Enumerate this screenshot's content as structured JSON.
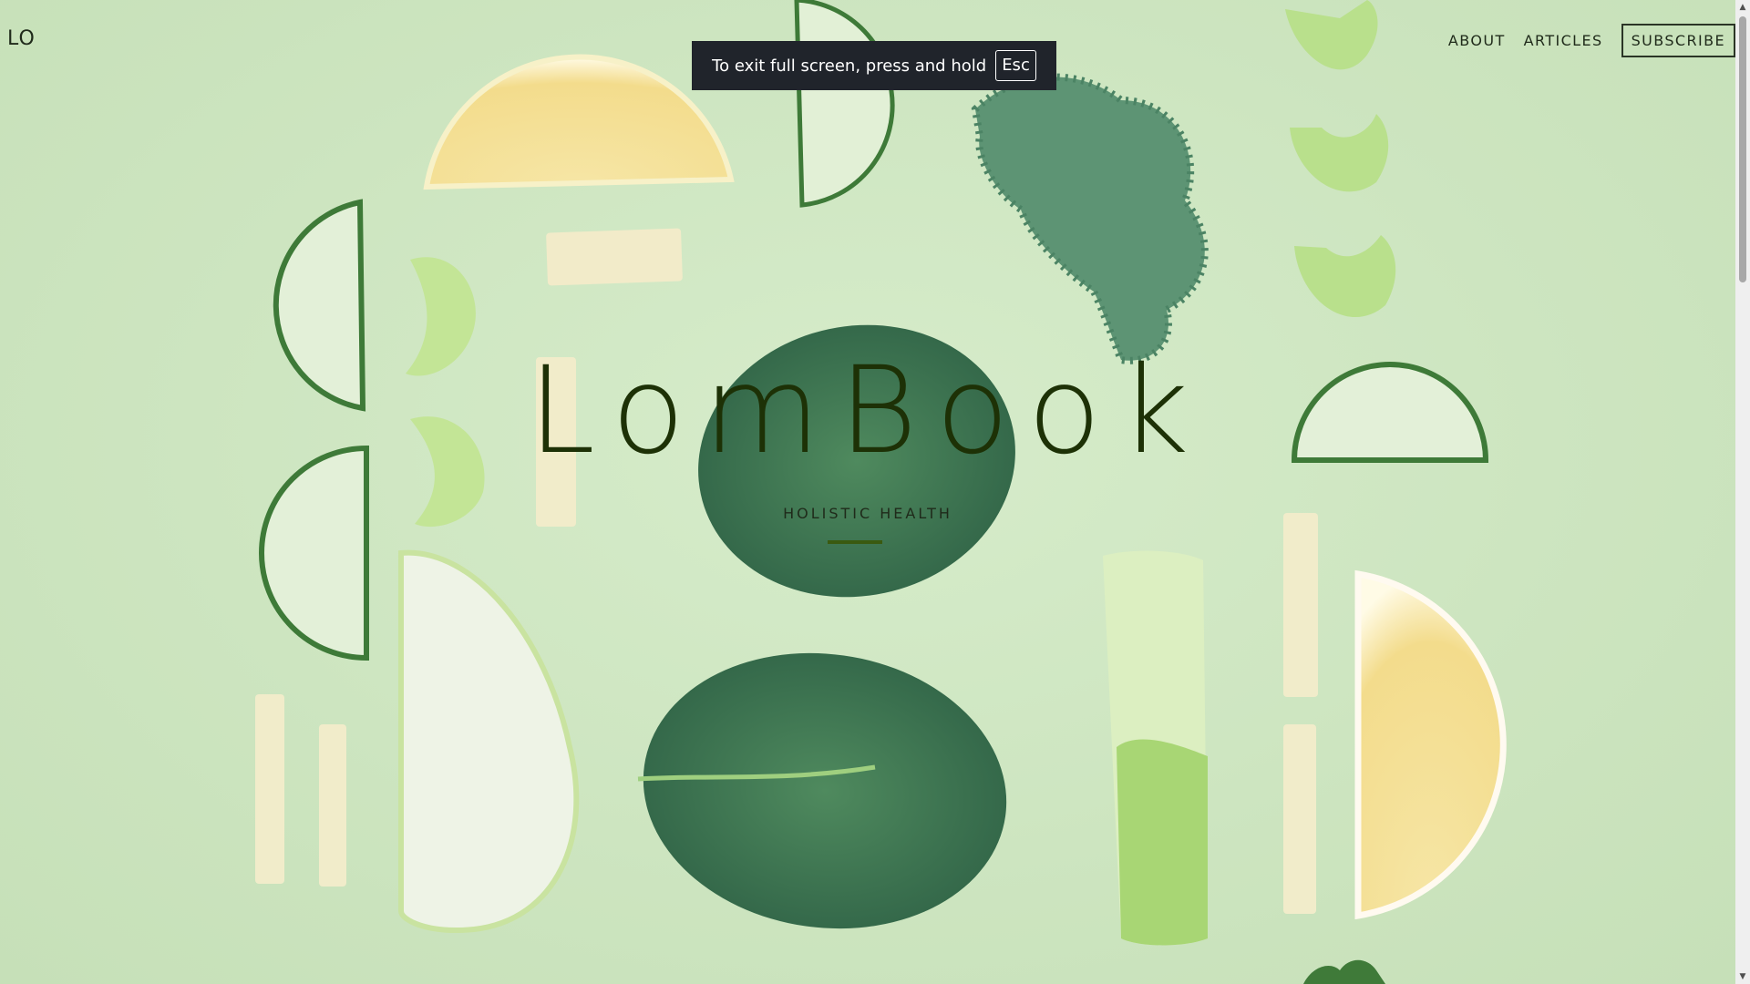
{
  "header": {
    "brand": "LO",
    "nav": [
      {
        "label": "ABOUT"
      },
      {
        "label": "ARTICLES"
      },
      {
        "label": "SUBSCRIBE"
      }
    ]
  },
  "fullscreen_notice": {
    "message": "To exit full screen, press and hold",
    "key": "Esc"
  },
  "hero": {
    "title": "LomBook",
    "subtitle": "HOLISTIC HEALTH",
    "background_image": "flat-lay of sliced vegetables: cucumber, lemon, celery, spinach, kale, lettuce, ginger",
    "colors": {
      "background": "#cfe6c4",
      "title": "#1d3106",
      "accent": "#3a5a10"
    }
  },
  "icons": {
    "scroll_up": "chevron-up-icon",
    "scroll_down": "chevron-down-icon"
  }
}
